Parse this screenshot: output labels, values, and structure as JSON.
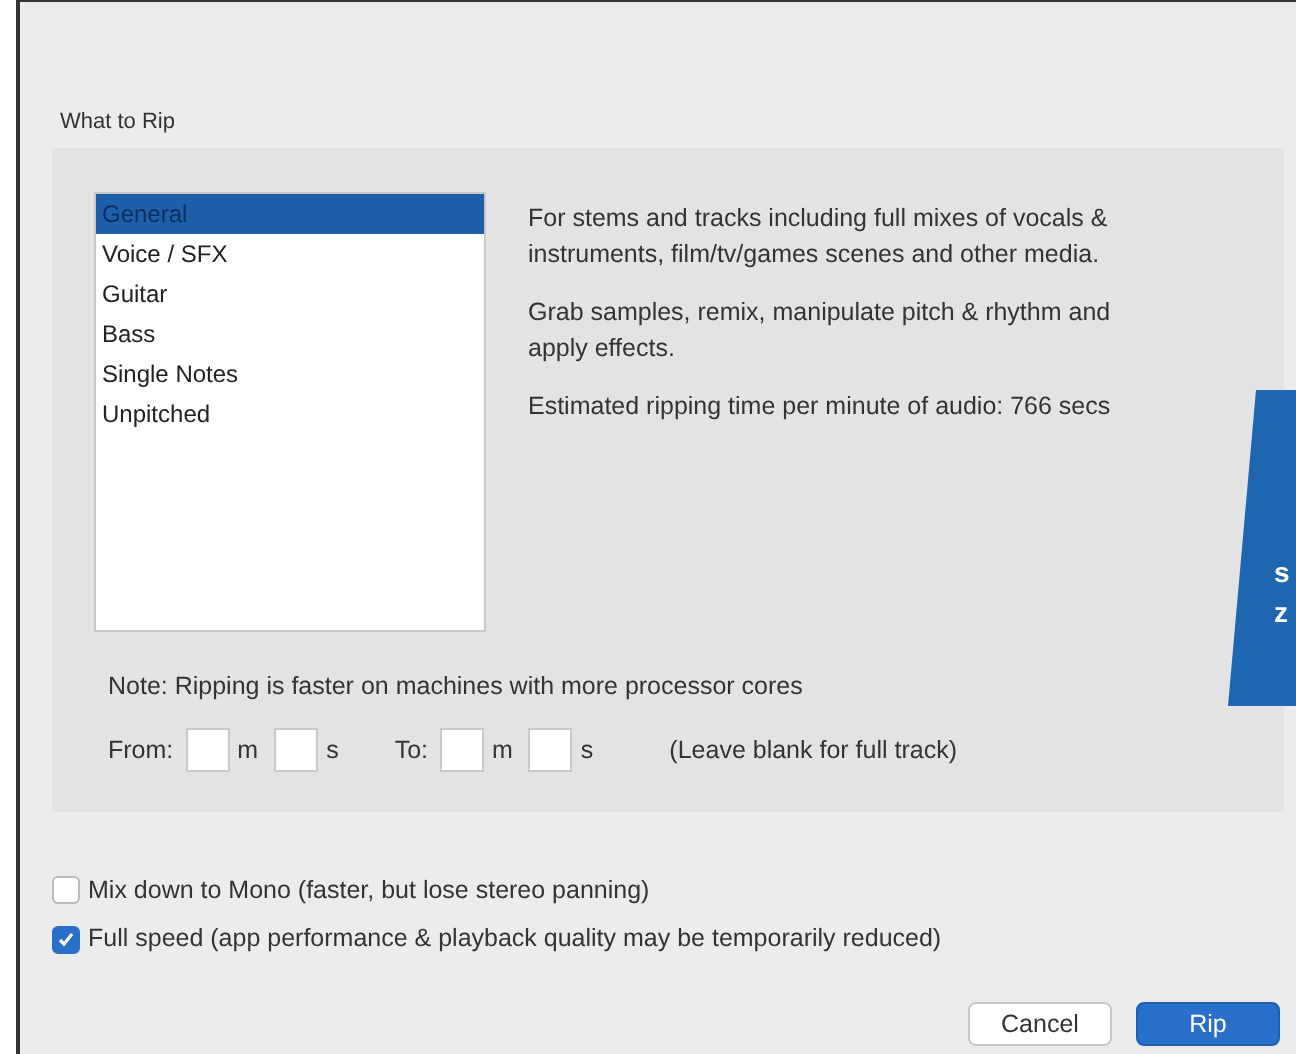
{
  "section_title": "What to Rip",
  "modes": [
    {
      "label": "General",
      "selected": true
    },
    {
      "label": "Voice / SFX",
      "selected": false
    },
    {
      "label": "Guitar",
      "selected": false
    },
    {
      "label": "Bass",
      "selected": false
    },
    {
      "label": "Single Notes",
      "selected": false
    },
    {
      "label": "Unpitched",
      "selected": false
    }
  ],
  "description": [
    "For stems and tracks including full mixes of vocals & instruments, film/tv/games scenes and other media.",
    "Grab samples, remix, manipulate pitch & rhythm and apply effects.",
    "Estimated ripping time per minute of audio: 766 secs"
  ],
  "note": "Note: Ripping is faster on machines with more processor cores",
  "range": {
    "from_label": "From:",
    "from_minutes_unit": "m",
    "from_seconds_unit": "s",
    "to_label": "To:",
    "to_minutes_unit": "m",
    "to_seconds_unit": "s",
    "hint": "(Leave blank for full track)"
  },
  "options": [
    {
      "label": "Mix down to Mono (faster, but lose stereo panning)",
      "checked": false
    },
    {
      "label": "Full speed (app performance & playback quality may be temporarily reduced)",
      "checked": true
    }
  ],
  "buttons": [
    {
      "label": "Cancel",
      "kind": "secondary"
    },
    {
      "label": "Rip",
      "kind": "primary"
    }
  ],
  "callout": {
    "fragments": [
      "s",
      "z"
    ]
  }
}
